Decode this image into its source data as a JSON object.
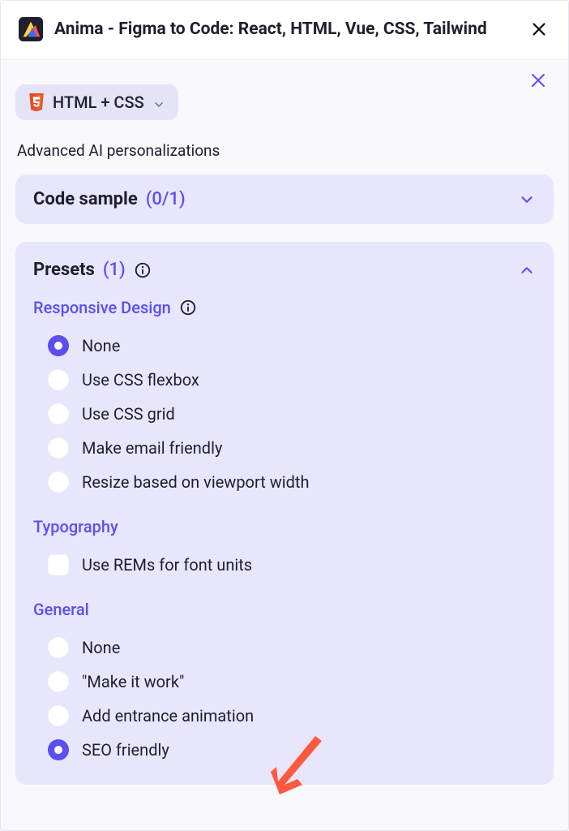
{
  "header": {
    "app_title": "Anima - Figma to Code: React, HTML, Vue, CSS, Tailwind"
  },
  "panel": {
    "framework_label": "HTML + CSS",
    "subtitle": "Advanced AI personalizations"
  },
  "sections": {
    "code_sample": {
      "title": "Code sample",
      "count": "(0/1)",
      "expanded": false
    },
    "presets": {
      "title": "Presets",
      "count": "(1)",
      "expanded": true,
      "groups": {
        "responsive": {
          "title": "Responsive Design",
          "type": "radio",
          "options": [
            {
              "label": "None",
              "selected": true
            },
            {
              "label": "Use CSS flexbox",
              "selected": false
            },
            {
              "label": "Use CSS grid",
              "selected": false
            },
            {
              "label": "Make email friendly",
              "selected": false
            },
            {
              "label": "Resize based on viewport width",
              "selected": false
            }
          ]
        },
        "typography": {
          "title": "Typography",
          "type": "checkbox",
          "options": [
            {
              "label": "Use REMs for font units",
              "checked": false
            }
          ]
        },
        "general": {
          "title": "General",
          "type": "radio",
          "options": [
            {
              "label": "None",
              "selected": false
            },
            {
              "label": "\"Make it work\"",
              "selected": false
            },
            {
              "label": "Add entrance animation",
              "selected": false
            },
            {
              "label": "SEO friendly",
              "selected": true
            }
          ]
        }
      }
    }
  }
}
